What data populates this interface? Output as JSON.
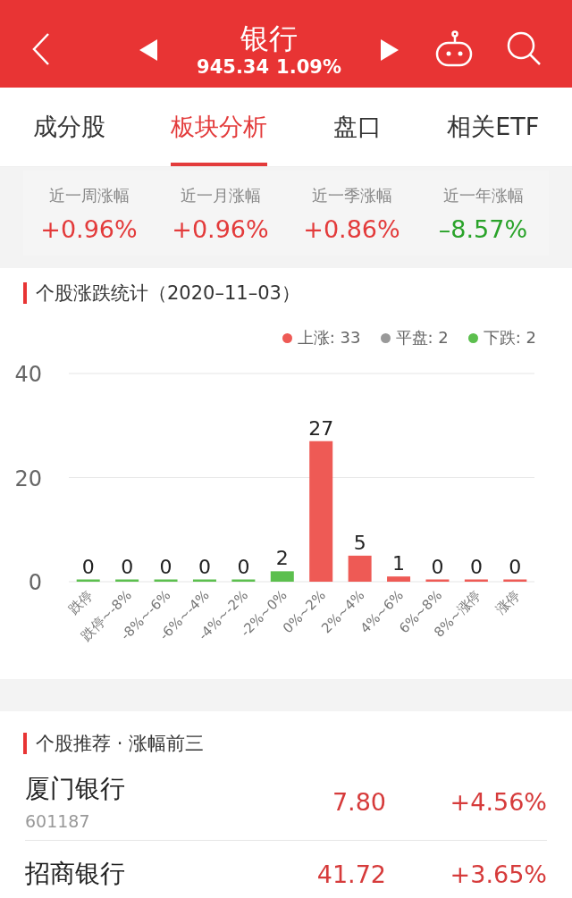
{
  "header": {
    "title": "银行",
    "price": "945.34",
    "change": "1.09%"
  },
  "tabs": [
    {
      "label": "成分股",
      "selected": false
    },
    {
      "label": "板块分析",
      "selected": true
    },
    {
      "label": "盘口",
      "selected": false
    },
    {
      "label": "相关ETF",
      "selected": false
    }
  ],
  "periods": [
    {
      "label": "近一周涨幅",
      "value": "+0.96%",
      "color": "#e33b3b"
    },
    {
      "label": "近一月涨幅",
      "value": "+0.96%",
      "color": "#e33b3b"
    },
    {
      "label": "近一季涨幅",
      "value": "+0.86%",
      "color": "#e33b3b"
    },
    {
      "label": "近一年涨幅",
      "value": "–8.57%",
      "color": "#2aa32a"
    }
  ],
  "distribution": {
    "title": "个股涨跌统计（2020–11–03）",
    "legend": [
      {
        "label": "上涨: 33",
        "color": "#ee5a55"
      },
      {
        "label": "平盘: 2",
        "color": "#999999"
      },
      {
        "label": "下跌: 2",
        "color": "#5cbf4e"
      }
    ],
    "chart_data": {
      "type": "bar",
      "data_labels": true,
      "ylim": [
        0,
        40
      ],
      "yticks": [
        0,
        20,
        40
      ],
      "categories": [
        "跌停",
        "跌停~-8%",
        "-8%~-6%",
        "-6%~-4%",
        "-4%~-2%",
        "-2%~0%",
        "0%~2%",
        "2%~4%",
        "4%~6%",
        "6%~8%",
        "8%~涨停",
        "涨停"
      ],
      "series": [
        {
          "color": "#5cbf4e",
          "values": [
            0,
            0,
            0,
            0,
            0,
            2,
            null,
            null,
            null,
            null,
            null,
            null
          ]
        },
        {
          "color": "#ee5a55",
          "values": [
            null,
            null,
            null,
            null,
            null,
            null,
            27,
            5,
            1,
            0,
            0,
            0
          ]
        }
      ]
    }
  },
  "recommend": {
    "title": "个股推荐 · 涨幅前三",
    "stocks": [
      {
        "name": "厦门银行",
        "code": "601187",
        "price": "7.80",
        "change": "+4.56%"
      },
      {
        "name": "招商银行",
        "price": "41.72",
        "change": "+3.65%"
      }
    ]
  }
}
